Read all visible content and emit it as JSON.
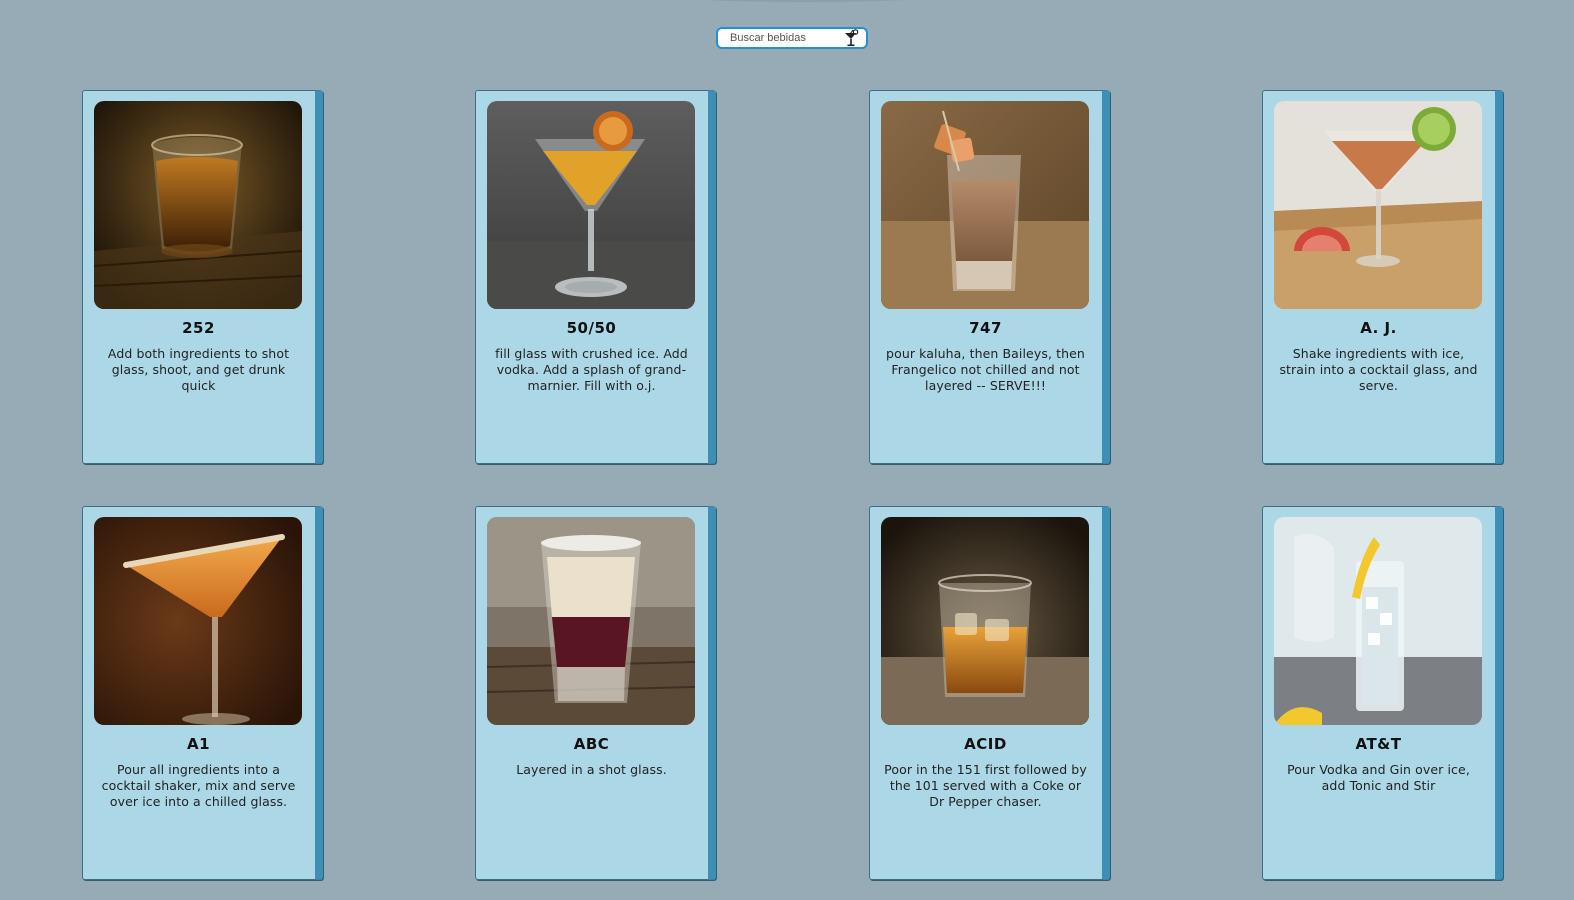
{
  "search": {
    "placeholder": "Buscar bebidas",
    "icon": "cocktail-icon"
  },
  "drinks": [
    {
      "name": "252",
      "description": "Add both ingredients to shot glass, shoot, and get drunk quick",
      "image": "amber-shot-on-wood"
    },
    {
      "name": "50/50",
      "description": "fill glass with crushed ice. Add vodka. Add a splash of grand-marnier. Fill with o.j.",
      "image": "martini-with-orange-peel"
    },
    {
      "name": "747",
      "description": "pour kaluha, then Baileys, then Frangelico not chilled and not layered -- SERVE!!!",
      "image": "creamy-shot-with-skewer"
    },
    {
      "name": "A. J.",
      "description": "Shake ingredients with ice, strain into a cocktail glass, and serve.",
      "image": "martini-with-lime-and-grapefruit"
    },
    {
      "name": "A1",
      "description": "Pour all ingredients into a cocktail shaker, mix and serve over ice into a chilled glass.",
      "image": "orange-martini-sugar-rim"
    },
    {
      "name": "ABC",
      "description": "Layered in a shot glass.",
      "image": "layered-shot"
    },
    {
      "name": "ACID",
      "description": "Poor in the 151 first followed by the 101 served with a Coke or Dr Pepper chaser.",
      "image": "whiskey-on-rocks"
    },
    {
      "name": "AT&T",
      "description": "Pour Vodka and Gin over ice, add Tonic and Stir",
      "image": "highball-with-lemon"
    }
  ]
}
